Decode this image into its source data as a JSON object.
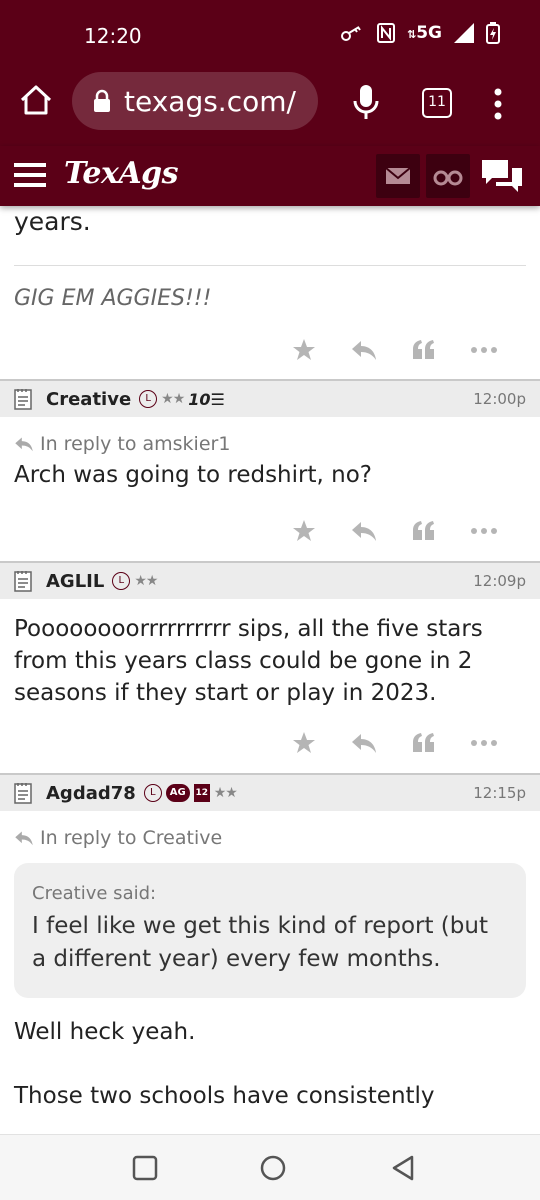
{
  "status_bar": {
    "time": "12:20",
    "network": "5G",
    "icons": [
      "key-icon",
      "nfc-icon",
      "data-arrows-icon",
      "signal-icon",
      "battery-charging-icon"
    ]
  },
  "browser": {
    "url": "texags.com/",
    "tab_count": "11"
  },
  "site": {
    "logo_text": "TexAgs"
  },
  "posts": {
    "prev": {
      "tail_text": "years.",
      "signature": "GIG EM AGGIES!!!"
    },
    "p1": {
      "username": "Creative",
      "badge_l": "L",
      "stars": "★★",
      "extra_badge": "10☰",
      "time": "12:00p",
      "reply_to": "In reply to amskier1",
      "body": "Arch was going to redshirt, no?"
    },
    "p2": {
      "username": "AGLIL",
      "badge_l": "L",
      "stars": "★★",
      "time": "12:09p",
      "body": "Poooooooorrrrrrrrrr sips, all the five stars from this years class could be gone in 2 seasons if they start or play in 2023."
    },
    "p3": {
      "username": "Agdad78",
      "badge_l": "L",
      "badge_ag": "AG",
      "badge_12": "12",
      "stars": "★★",
      "time": "12:15p",
      "reply_to": "In reply to Creative",
      "quote_author": "Creative said:",
      "quote_text": "I feel like we get this kind of report (but a different year) every few months.",
      "body_1": "Well heck yeah.",
      "body_2": "Those two schools have consistently"
    }
  },
  "colors": {
    "brand": "#5b0017",
    "header_gray": "#ececec",
    "icon_gray": "#b5b5b5"
  }
}
